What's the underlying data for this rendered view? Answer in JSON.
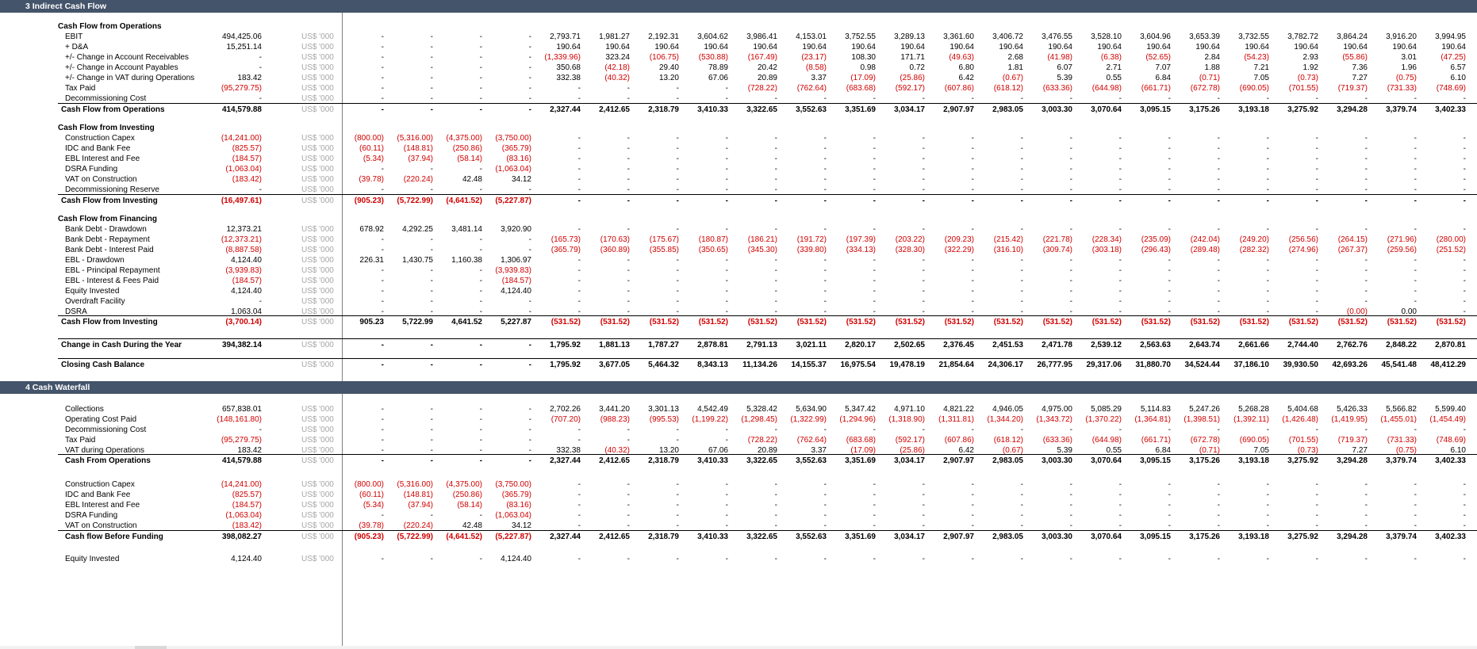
{
  "sections": [
    {
      "title": "3   Indirect Cash Flow"
    },
    {
      "title": "4   Cash Waterfall"
    }
  ],
  "unit_label": "US$ '000",
  "rows": [
    {
      "sec": 0
    },
    {
      "label": "Cash Flow from Operations",
      "type": "h"
    },
    {
      "label": "EBIT",
      "total": "494,425.06",
      "v": [
        "-",
        "-",
        "-",
        "-",
        "2,793.71",
        "1,981.27",
        "2,192.31",
        "3,604.62",
        "3,986.41",
        "4,153.01",
        "3,752.55",
        "3,289.13",
        "3,361.60",
        "3,406.72",
        "3,476.55",
        "3,528.10",
        "3,604.96",
        "3,653.39",
        "3,732.55",
        "3,782.72",
        "3,864.24",
        "3,916.20",
        "3,994.95"
      ]
    },
    {
      "label": "+ D&A",
      "total": "15,251.14",
      "v": [
        "-",
        "-",
        "-",
        "-",
        "190.64",
        "190.64",
        "190.64",
        "190.64",
        "190.64",
        "190.64",
        "190.64",
        "190.64",
        "190.64",
        "190.64",
        "190.64",
        "190.64",
        "190.64",
        "190.64",
        "190.64",
        "190.64",
        "190.64",
        "190.64",
        "190.64"
      ]
    },
    {
      "label": "+/- Change in Account Receivables",
      "total": "-",
      "v": [
        "-",
        "-",
        "-",
        "-",
        "(1,339.96)",
        "323.24",
        "(106.75)",
        "(530.88)",
        "(167.49)",
        "(23.17)",
        "108.30",
        "171.71",
        "(49.63)",
        "2.68",
        "(41.98)",
        "(6.38)",
        "(52.65)",
        "2.84",
        "(54.23)",
        "2.93",
        "(55.86)",
        "3.01",
        "(47.25)"
      ]
    },
    {
      "label": "+/- Change in Account Payables",
      "total": "-",
      "v": [
        "-",
        "-",
        "-",
        "-",
        "350.68",
        "(42.18)",
        "29.40",
        "78.89",
        "20.42",
        "(8.58)",
        "0.98",
        "0.72",
        "6.80",
        "1.81",
        "6.07",
        "2.71",
        "7.07",
        "1.88",
        "7.21",
        "1.92",
        "7.36",
        "1.96",
        "6.57"
      ]
    },
    {
      "label": "+/- Change in VAT during Operations",
      "total": "183.42",
      "v": [
        "-",
        "-",
        "-",
        "-",
        "332.38",
        "(40.32)",
        "13.20",
        "67.06",
        "20.89",
        "3.37",
        "(17.09)",
        "(25.86)",
        "6.42",
        "(0.67)",
        "5.39",
        "0.55",
        "6.84",
        "(0.71)",
        "7.05",
        "(0.73)",
        "7.27",
        "(0.75)",
        "6.10"
      ]
    },
    {
      "label": "Tax Paid",
      "total": "(95,279.75)",
      "v": [
        "-",
        "-",
        "-",
        "-",
        "-",
        "-",
        "-",
        "-",
        "(728.22)",
        "(762.64)",
        "(683.68)",
        "(592.17)",
        "(607.86)",
        "(618.12)",
        "(633.36)",
        "(644.98)",
        "(661.71)",
        "(672.78)",
        "(690.05)",
        "(701.55)",
        "(719.37)",
        "(731.33)",
        "(748.69)"
      ]
    },
    {
      "label": "Decommissioning Cost",
      "total": "-",
      "v": [
        "-",
        "-",
        "-",
        "-",
        "-",
        "-",
        "-",
        "-",
        "-",
        "-",
        "-",
        "-",
        "-",
        "-",
        "-",
        "-",
        "-",
        "-",
        "-",
        "-",
        "-",
        "-",
        "-"
      ]
    },
    {
      "label": "Cash Flow from Operations",
      "type": "t",
      "total": "414,579.88",
      "v": [
        "-",
        "-",
        "-",
        "-",
        "2,327.44",
        "2,412.65",
        "2,318.79",
        "3,410.33",
        "3,322.65",
        "3,552.63",
        "3,351.69",
        "3,034.17",
        "2,907.97",
        "2,983.05",
        "3,003.30",
        "3,070.64",
        "3,095.15",
        "3,175.26",
        "3,193.18",
        "3,275.92",
        "3,294.28",
        "3,379.74",
        "3,402.33"
      ]
    },
    {
      "type": "blank"
    },
    {
      "label": "Cash Flow from Investing",
      "type": "h"
    },
    {
      "label": "Construction Capex",
      "total": "(14,241.00)",
      "v": [
        "(800.00)",
        "(5,316.00)",
        "(4,375.00)",
        "(3,750.00)",
        "-",
        "-",
        "-",
        "-",
        "-",
        "-",
        "-",
        "-",
        "-",
        "-",
        "-",
        "-",
        "-",
        "-",
        "-",
        "-",
        "-",
        "-",
        "-"
      ]
    },
    {
      "label": "IDC and Bank Fee",
      "total": "(825.57)",
      "v": [
        "(60.11)",
        "(148.81)",
        "(250.86)",
        "(365.79)",
        "-",
        "-",
        "-",
        "-",
        "-",
        "-",
        "-",
        "-",
        "-",
        "-",
        "-",
        "-",
        "-",
        "-",
        "-",
        "-",
        "-",
        "-",
        "-"
      ]
    },
    {
      "label": "EBL Interest and Fee",
      "total": "(184.57)",
      "v": [
        "(5.34)",
        "(37.94)",
        "(58.14)",
        "(83.16)",
        "-",
        "-",
        "-",
        "-",
        "-",
        "-",
        "-",
        "-",
        "-",
        "-",
        "-",
        "-",
        "-",
        "-",
        "-",
        "-",
        "-",
        "-",
        "-"
      ]
    },
    {
      "label": "DSRA Funding",
      "total": "(1,063.04)",
      "v": [
        "-",
        "-",
        "-",
        "(1,063.04)",
        "-",
        "-",
        "-",
        "-",
        "-",
        "-",
        "-",
        "-",
        "-",
        "-",
        "-",
        "-",
        "-",
        "-",
        "-",
        "-",
        "-",
        "-",
        "-"
      ]
    },
    {
      "label": "VAT on Construction",
      "total": "(183.42)",
      "v": [
        "(39.78)",
        "(220.24)",
        "42.48",
        "34.12",
        "-",
        "-",
        "-",
        "-",
        "-",
        "-",
        "-",
        "-",
        "-",
        "-",
        "-",
        "-",
        "-",
        "-",
        "-",
        "-",
        "-",
        "-",
        "-"
      ]
    },
    {
      "label": "Decommissioning Reserve",
      "total": "-",
      "v": [
        "-",
        "-",
        "-",
        "-",
        "-",
        "-",
        "-",
        "-",
        "-",
        "-",
        "-",
        "-",
        "-",
        "-",
        "-",
        "-",
        "-",
        "-",
        "-",
        "-",
        "-",
        "-",
        "-"
      ]
    },
    {
      "label": "Cash Flow from Investing",
      "type": "t",
      "total": "(16,497.61)",
      "v": [
        "(905.23)",
        "(5,722.99)",
        "(4,641.52)",
        "(5,227.87)",
        "-",
        "-",
        "-",
        "-",
        "-",
        "-",
        "-",
        "-",
        "-",
        "-",
        "-",
        "-",
        "-",
        "-",
        "-",
        "-",
        "-",
        "-",
        "-"
      ]
    },
    {
      "type": "blank"
    },
    {
      "label": "Cash Flow from Financing",
      "type": "h"
    },
    {
      "label": "Bank Debt - Drawdown",
      "total": "12,373.21",
      "v": [
        "678.92",
        "4,292.25",
        "3,481.14",
        "3,920.90",
        "-",
        "-",
        "-",
        "-",
        "-",
        "-",
        "-",
        "-",
        "-",
        "-",
        "-",
        "-",
        "-",
        "-",
        "-",
        "-",
        "-",
        "-",
        "-"
      ]
    },
    {
      "label": "Bank Debt - Repayment",
      "total": "(12,373.21)",
      "v": [
        "-",
        "-",
        "-",
        "-",
        "(165.73)",
        "(170.63)",
        "(175.67)",
        "(180.87)",
        "(186.21)",
        "(191.72)",
        "(197.39)",
        "(203.22)",
        "(209.23)",
        "(215.42)",
        "(221.78)",
        "(228.34)",
        "(235.09)",
        "(242.04)",
        "(249.20)",
        "(256.56)",
        "(264.15)",
        "(271.96)",
        "(280.00)"
      ]
    },
    {
      "label": "Bank Debt - Interest Paid",
      "total": "(8,887.58)",
      "v": [
        "-",
        "-",
        "-",
        "-",
        "(365.79)",
        "(360.89)",
        "(355.85)",
        "(350.65)",
        "(345.30)",
        "(339.80)",
        "(334.13)",
        "(328.30)",
        "(322.29)",
        "(316.10)",
        "(309.74)",
        "(303.18)",
        "(296.43)",
        "(289.48)",
        "(282.32)",
        "(274.96)",
        "(267.37)",
        "(259.56)",
        "(251.52)"
      ]
    },
    {
      "label": "EBL - Drawdown",
      "total": "4,124.40",
      "v": [
        "226.31",
        "1,430.75",
        "1,160.38",
        "1,306.97",
        "-",
        "-",
        "-",
        "-",
        "-",
        "-",
        "-",
        "-",
        "-",
        "-",
        "-",
        "-",
        "-",
        "-",
        "-",
        "-",
        "-",
        "-",
        "-"
      ]
    },
    {
      "label": "EBL - Principal Repayment",
      "total": "(3,939.83)",
      "v": [
        "-",
        "-",
        "-",
        "(3,939.83)",
        "-",
        "-",
        "-",
        "-",
        "-",
        "-",
        "-",
        "-",
        "-",
        "-",
        "-",
        "-",
        "-",
        "-",
        "-",
        "-",
        "-",
        "-",
        "-"
      ]
    },
    {
      "label": "EBL - Interest & Fees Paid",
      "total": "(184.57)",
      "v": [
        "-",
        "-",
        "-",
        "(184.57)",
        "-",
        "-",
        "-",
        "-",
        "-",
        "-",
        "-",
        "-",
        "-",
        "-",
        "-",
        "-",
        "-",
        "-",
        "-",
        "-",
        "-",
        "-",
        "-"
      ]
    },
    {
      "label": "Equity Invested",
      "total": "4,124.40",
      "v": [
        "-",
        "-",
        "-",
        "4,124.40",
        "-",
        "-",
        "-",
        "-",
        "-",
        "-",
        "-",
        "-",
        "-",
        "-",
        "-",
        "-",
        "-",
        "-",
        "-",
        "-",
        "-",
        "-",
        "-"
      ]
    },
    {
      "label": "Overdraft Facility",
      "total": "-",
      "v": [
        "-",
        "-",
        "-",
        "-",
        "-",
        "-",
        "-",
        "-",
        "-",
        "-",
        "-",
        "-",
        "-",
        "-",
        "-",
        "-",
        "-",
        "-",
        "-",
        "-",
        "-",
        "-",
        "-"
      ]
    },
    {
      "label": "DSRA",
      "total": "1,063.04",
      "v": [
        "-",
        "-",
        "-",
        "-",
        "-",
        "-",
        "-",
        "-",
        "-",
        "-",
        "-",
        "-",
        "-",
        "-",
        "-",
        "-",
        "-",
        "-",
        "-",
        "-",
        "(0.00)",
        "0.00",
        "-"
      ]
    },
    {
      "label": "Cash Flow from Investing",
      "type": "t",
      "total": "(3,700.14)",
      "v": [
        "905.23",
        "5,722.99",
        "4,641.52",
        "5,227.87",
        "(531.52)",
        "(531.52)",
        "(531.52)",
        "(531.52)",
        "(531.52)",
        "(531.52)",
        "(531.52)",
        "(531.52)",
        "(531.52)",
        "(531.52)",
        "(531.52)",
        "(531.52)",
        "(531.52)",
        "(531.52)",
        "(531.52)",
        "(531.52)",
        "(531.52)",
        "(531.52)",
        "(531.52)"
      ]
    },
    {
      "type": "blank"
    },
    {
      "label": "Change in Cash During the Year",
      "type": "t",
      "total": "394,382.14",
      "v": [
        "-",
        "-",
        "-",
        "-",
        "1,795.92",
        "1,881.13",
        "1,787.27",
        "2,878.81",
        "2,791.13",
        "3,021.11",
        "2,820.17",
        "2,502.65",
        "2,376.45",
        "2,451.53",
        "2,471.78",
        "2,539.12",
        "2,563.63",
        "2,643.74",
        "2,661.66",
        "2,744.40",
        "2,762.76",
        "2,848.22",
        "2,870.81"
      ]
    },
    {
      "type": "blank"
    },
    {
      "label": "Closing Cash Balance",
      "type": "t",
      "total": "",
      "v": [
        "-",
        "-",
        "-",
        "-",
        "1,795.92",
        "3,677.05",
        "5,464.32",
        "8,343.13",
        "11,134.26",
        "14,155.37",
        "16,975.54",
        "19,478.19",
        "21,854.64",
        "24,306.17",
        "26,777.95",
        "29,317.06",
        "31,880.70",
        "34,524.44",
        "37,186.10",
        "39,930.50",
        "42,693.26",
        "45,541.48",
        "48,412.29"
      ]
    },
    {
      "type": "blank"
    },
    {
      "sec": 1
    },
    {
      "type": "blank"
    },
    {
      "label": "Collections",
      "total": "657,838.01",
      "v": [
        "-",
        "-",
        "-",
        "-",
        "2,702.26",
        "3,441.20",
        "3,301.13",
        "4,542.49",
        "5,328.42",
        "5,634.90",
        "5,347.42",
        "4,971.10",
        "4,821.22",
        "4,946.05",
        "4,975.00",
        "5,085.29",
        "5,114.83",
        "5,247.26",
        "5,268.28",
        "5,404.68",
        "5,426.33",
        "5,566.82",
        "5,599.40"
      ]
    },
    {
      "label": "Operating Cost Paid",
      "total": "(148,161.80)",
      "v": [
        "-",
        "-",
        "-",
        "-",
        "(707.20)",
        "(988.23)",
        "(995.53)",
        "(1,199.22)",
        "(1,298.45)",
        "(1,322.99)",
        "(1,294.96)",
        "(1,318.90)",
        "(1,311.81)",
        "(1,344.20)",
        "(1,343.72)",
        "(1,370.22)",
        "(1,364.81)",
        "(1,398.51)",
        "(1,392.11)",
        "(1,426.48)",
        "(1,419.95)",
        "(1,455.01)",
        "(1,454.49)"
      ]
    },
    {
      "label": "Decommissioning Cost",
      "total": "-",
      "v": [
        "-",
        "-",
        "-",
        "-",
        "-",
        "-",
        "-",
        "-",
        "-",
        "-",
        "-",
        "-",
        "-",
        "-",
        "-",
        "-",
        "-",
        "-",
        "-",
        "-",
        "-",
        "-",
        "-"
      ]
    },
    {
      "label": "Tax Paid",
      "total": "(95,279.75)",
      "v": [
        "-",
        "-",
        "-",
        "-",
        "-",
        "-",
        "-",
        "-",
        "(728.22)",
        "(762.64)",
        "(683.68)",
        "(592.17)",
        "(607.86)",
        "(618.12)",
        "(633.36)",
        "(644.98)",
        "(661.71)",
        "(672.78)",
        "(690.05)",
        "(701.55)",
        "(719.37)",
        "(731.33)",
        "(748.69)"
      ]
    },
    {
      "label": "VAT during Operations",
      "total": "183.42",
      "v": [
        "-",
        "-",
        "-",
        "-",
        "332.38",
        "(40.32)",
        "13.20",
        "67.06",
        "20.89",
        "3.37",
        "(17.09)",
        "(25.86)",
        "6.42",
        "(0.67)",
        "5.39",
        "0.55",
        "6.84",
        "(0.71)",
        "7.05",
        "(0.73)",
        "7.27",
        "(0.75)",
        "6.10"
      ]
    },
    {
      "label": "Cash From Operations",
      "type": "t2",
      "total": "414,579.88",
      "v": [
        "-",
        "-",
        "-",
        "-",
        "2,327.44",
        "2,412.65",
        "2,318.79",
        "3,410.33",
        "3,322.65",
        "3,552.63",
        "3,351.69",
        "3,034.17",
        "2,907.97",
        "2,983.05",
        "3,003.30",
        "3,070.64",
        "3,095.15",
        "3,175.26",
        "3,193.18",
        "3,275.92",
        "3,294.28",
        "3,379.74",
        "3,402.33"
      ]
    },
    {
      "type": "blank"
    },
    {
      "label": "Construction Capex",
      "total": "(14,241.00)",
      "v": [
        "(800.00)",
        "(5,316.00)",
        "(4,375.00)",
        "(3,750.00)",
        "-",
        "-",
        "-",
        "-",
        "-",
        "-",
        "-",
        "-",
        "-",
        "-",
        "-",
        "-",
        "-",
        "-",
        "-",
        "-",
        "-",
        "-",
        "-"
      ]
    },
    {
      "label": "IDC and Bank Fee",
      "total": "(825.57)",
      "v": [
        "(60.11)",
        "(148.81)",
        "(250.86)",
        "(365.79)",
        "-",
        "-",
        "-",
        "-",
        "-",
        "-",
        "-",
        "-",
        "-",
        "-",
        "-",
        "-",
        "-",
        "-",
        "-",
        "-",
        "-",
        "-",
        "-"
      ]
    },
    {
      "label": "EBL Interest and Fee",
      "total": "(184.57)",
      "v": [
        "(5.34)",
        "(37.94)",
        "(58.14)",
        "(83.16)",
        "-",
        "-",
        "-",
        "-",
        "-",
        "-",
        "-",
        "-",
        "-",
        "-",
        "-",
        "-",
        "-",
        "-",
        "-",
        "-",
        "-",
        "-",
        "-"
      ]
    },
    {
      "label": "DSRA Funding",
      "total": "(1,063.04)",
      "v": [
        "-",
        "-",
        "-",
        "(1,063.04)",
        "-",
        "-",
        "-",
        "-",
        "-",
        "-",
        "-",
        "-",
        "-",
        "-",
        "-",
        "-",
        "-",
        "-",
        "-",
        "-",
        "-",
        "-",
        "-"
      ]
    },
    {
      "label": "VAT on Construction",
      "total": "(183.42)",
      "v": [
        "(39.78)",
        "(220.24)",
        "42.48",
        "34.12",
        "-",
        "-",
        "-",
        "-",
        "-",
        "-",
        "-",
        "-",
        "-",
        "-",
        "-",
        "-",
        "-",
        "-",
        "-",
        "-",
        "-",
        "-",
        "-"
      ]
    },
    {
      "label": "Cash flow Before Funding",
      "type": "t2",
      "total": "398,082.27",
      "v": [
        "(905.23)",
        "(5,722.99)",
        "(4,641.52)",
        "(5,227.87)",
        "2,327.44",
        "2,412.65",
        "2,318.79",
        "3,410.33",
        "3,322.65",
        "3,552.63",
        "3,351.69",
        "3,034.17",
        "2,907.97",
        "2,983.05",
        "3,003.30",
        "3,070.64",
        "3,095.15",
        "3,175.26",
        "3,193.18",
        "3,275.92",
        "3,294.28",
        "3,379.74",
        "3,402.33"
      ]
    },
    {
      "type": "blank"
    },
    {
      "label": "Equity Invested",
      "total": "4,124.40",
      "v": [
        "-",
        "-",
        "-",
        "4,124.40",
        "-",
        "-",
        "-",
        "-",
        "-",
        "-",
        "-",
        "-",
        "-",
        "-",
        "-",
        "-",
        "-",
        "-",
        "-",
        "-",
        "-",
        "-",
        "-"
      ]
    }
  ]
}
